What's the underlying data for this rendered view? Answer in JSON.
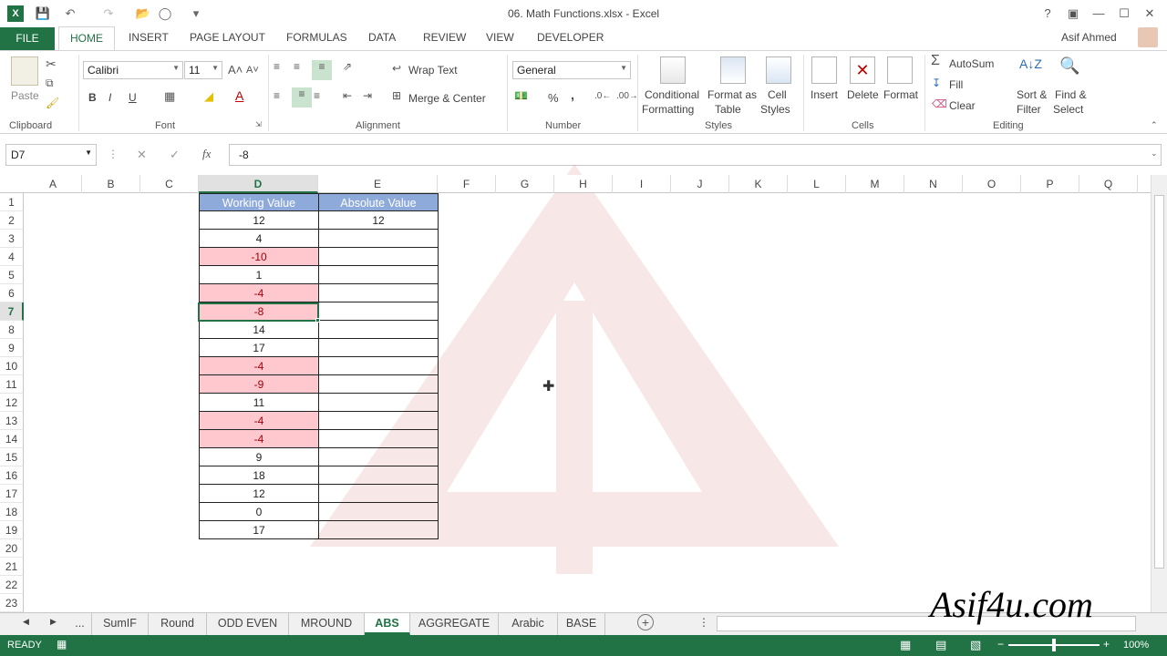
{
  "window": {
    "title": "06. Math Functions.xlsx - Excel",
    "user": "Asif Ahmed"
  },
  "tabs": [
    "FILE",
    "HOME",
    "INSERT",
    "PAGE LAYOUT",
    "FORMULAS",
    "DATA",
    "REVIEW",
    "VIEW",
    "DEVELOPER"
  ],
  "ribbon": {
    "clipboard": {
      "paste": "Paste",
      "label": "Clipboard"
    },
    "font": {
      "name": "Calibri",
      "size": "11",
      "bold": "B",
      "italic": "I",
      "underline": "U",
      "label": "Font"
    },
    "alignment": {
      "wrap": "Wrap Text",
      "merge": "Merge & Center",
      "label": "Alignment"
    },
    "number": {
      "format": "General",
      "percent": "%",
      "comma": ",",
      "label": "Number"
    },
    "styles": {
      "cond1": "Conditional",
      "cond2": "Formatting",
      "fmt1": "Format as",
      "fmt2": "Table",
      "cell1": "Cell",
      "cell2": "Styles",
      "label": "Styles"
    },
    "cells": {
      "insert": "Insert",
      "delete": "Delete",
      "format": "Format",
      "label": "Cells"
    },
    "editing": {
      "autosum": "AutoSum",
      "fill": "Fill",
      "clear": "Clear",
      "sort1": "Sort &",
      "sort2": "Filter",
      "find1": "Find &",
      "find2": "Select",
      "label": "Editing"
    }
  },
  "formula_bar": {
    "name_box": "D7",
    "fx": "fx",
    "content": "-8"
  },
  "columns": [
    "A",
    "B",
    "C",
    "D",
    "E",
    "F",
    "G",
    "H",
    "I",
    "J",
    "K",
    "L",
    "M",
    "N",
    "O",
    "P",
    "Q"
  ],
  "rows": [
    "1",
    "2",
    "3",
    "4",
    "5",
    "6",
    "7",
    "8",
    "9",
    "10",
    "11",
    "12",
    "13",
    "14",
    "15",
    "16",
    "17",
    "18",
    "19",
    "20",
    "21",
    "22",
    "23"
  ],
  "table": {
    "header_d": "Working Value",
    "header_e": "Absolute Value",
    "values": [
      "12",
      "4",
      "-10",
      "1",
      "-4",
      "-8",
      "14",
      "17",
      "-4",
      "-9",
      "11",
      "-4",
      "-4",
      "9",
      "18",
      "12",
      "0",
      "17"
    ],
    "abs_values": [
      "12"
    ]
  },
  "sheets": [
    "...",
    "SumIF",
    "Round",
    "ODD EVEN",
    "MROUND",
    "ABS",
    "AGGREGATE",
    "Arabic",
    "BASE"
  ],
  "active_sheet": "ABS",
  "status": {
    "mode": "READY",
    "zoom": "100%"
  },
  "watermark": {
    "brand": "Asif4u.com"
  },
  "colors": {
    "excel_green": "#217346",
    "header_fill": "#8eaadb",
    "negative_fill": "#ffc7ce",
    "negative_text": "#9c0006"
  }
}
